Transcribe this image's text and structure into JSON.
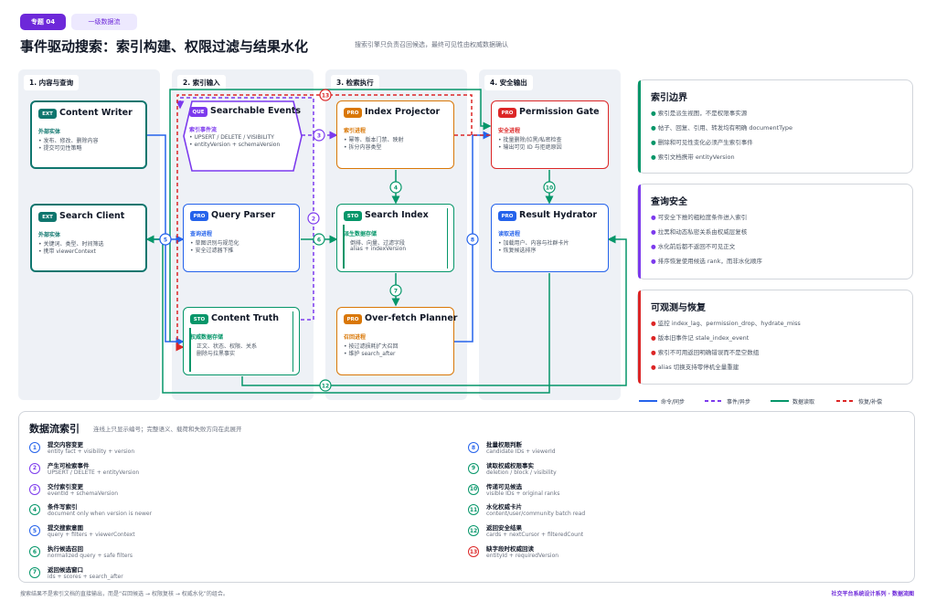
{
  "header": {
    "topic_tag": "专题 04",
    "level_tag": "一级数据流",
    "title": "事件驱动搜索：索引构建、权限过滤与结果水化",
    "subtitle": "搜索引擎只负责召回候选，最终可见性由权威数据确认"
  },
  "lanes": [
    {
      "title": "1. 内容与查询"
    },
    {
      "title": "2. 索引输入"
    },
    {
      "title": "3. 检索执行"
    },
    {
      "title": "4. 安全输出"
    }
  ],
  "nodes": {
    "content_writer": {
      "badge": "EXT",
      "name": "Content Writer",
      "role": "外部实体",
      "b1": "• 发布、修改、删除内容",
      "b2": "• 提交可见性策略"
    },
    "search_client": {
      "badge": "EXT",
      "name": "Search Client",
      "role": "外部实体",
      "b1": "• 关键词、类型、时间筛选",
      "b2": "• 携带 viewerContext"
    },
    "searchable_events": {
      "badge": "QUE",
      "name": "Searchable Events",
      "role": "索引事件流",
      "b1": "• UPSERT / DELETE / VISIBILITY",
      "b2": "• entityVersion + schemaVersion"
    },
    "query_parser": {
      "badge": "PRO",
      "name": "Query Parser",
      "role": "查询进程",
      "b1": "• 草图识别与规范化",
      "b2": "• 安全过滤器下推"
    },
    "content_truth": {
      "badge": "STO",
      "name": "Content Truth",
      "role": "权威数据存储",
      "b1": "正文、状态、权限、关系",
      "b2": "删除与拉黑事实"
    },
    "index_projector": {
      "badge": "PRO",
      "name": "Index Projector",
      "role": "索引进程",
      "b1": "• 幂等、版本门禁、映射",
      "b2": "• 拆分内容类型"
    },
    "search_index": {
      "badge": "STO",
      "name": "Search Index",
      "role": "派生数据存储",
      "b1": "倒排、向量、过滤字段",
      "b2": "alias + indexVersion"
    },
    "over_fetch_planner": {
      "badge": "PRO",
      "name": "Over-fetch Planner",
      "role": "召回进程",
      "b1": "• 按过滤损耗扩大召回",
      "b2": "• 维护 search_after"
    },
    "permission_gate": {
      "badge": "PRO",
      "name": "Permission Gate",
      "role": "安全进程",
      "b1": "• 批量删除/拉黑/私密检查",
      "b2": "• 输出可见 ID 与拒绝原因"
    },
    "result_hydrator": {
      "badge": "PRO",
      "name": "Result Hydrator",
      "role": "读取进程",
      "b1": "• 加载用户、内容与社群卡片",
      "b2": "• 恢复候选排序"
    }
  },
  "edge_numbers": [
    "1",
    "2",
    "3",
    "4",
    "5",
    "6",
    "7",
    "8",
    "9",
    "10",
    "11",
    "12",
    "13"
  ],
  "panels": [
    {
      "title": "索引边界",
      "color": "#059669",
      "items": [
        "索引是派生视图，不是权限事实源",
        "帖子、回复、引用、转发均有明确 documentType",
        "删除和可见性变化必须产生索引事件",
        "索引文档携带 entityVersion"
      ]
    },
    {
      "title": "查询安全",
      "color": "#7c3aed",
      "items": [
        "可安全下推的粗粒度条件进入索引",
        "拉黑和动态私密关系由权威层复核",
        "水化前后都不返回不可见正文",
        "排序恢复使用候选 rank，而非水化顺序"
      ]
    },
    {
      "title": "可观测与恢复",
      "color": "#dc2626",
      "items": [
        "监控 index_lag、permission_drop、hydrate_miss",
        "版本旧事件记 stale_index_event",
        "索引不可用返回明确错误而不是空数组",
        "alias 切换支持零停机全量重建"
      ]
    }
  ],
  "legend": [
    {
      "label": "命令/同步",
      "color": "#2563eb",
      "style": "solid"
    },
    {
      "label": "事件/异步",
      "color": "#7c3aed",
      "style": "dashed"
    },
    {
      "label": "数据读取",
      "color": "#059669",
      "style": "solid"
    },
    {
      "label": "恢复/补偿",
      "color": "#dc2626",
      "style": "dashed"
    }
  ],
  "index": {
    "title": "数据流索引",
    "desc": "连线上只显示编号；完整语义、载荷和失败方向在此展开",
    "items": [
      {
        "n": "1",
        "color": "#2563eb",
        "h": "提交内容变更",
        "s": "entity fact + visibility + version"
      },
      {
        "n": "2",
        "color": "#7c3aed",
        "h": "产生可检索事件",
        "s": "UPSERT / DELETE + entityVersion"
      },
      {
        "n": "3",
        "color": "#7c3aed",
        "h": "交付索引变更",
        "s": "eventId + schemaVersion"
      },
      {
        "n": "4",
        "color": "#059669",
        "h": "条件写索引",
        "s": "document only when version is newer"
      },
      {
        "n": "5",
        "color": "#2563eb",
        "h": "提交搜索意图",
        "s": "query + filters + viewerContext"
      },
      {
        "n": "6",
        "color": "#059669",
        "h": "执行候选召回",
        "s": "normalized query + safe filters"
      },
      {
        "n": "7",
        "color": "#059669",
        "h": "返回候选窗口",
        "s": "ids + scores + search_after"
      },
      {
        "n": "8",
        "color": "#2563eb",
        "h": "批量权限判断",
        "s": "candidate IDs + viewerId"
      },
      {
        "n": "9",
        "color": "#059669",
        "h": "读取权威权限事实",
        "s": "deletion / block / visibility"
      },
      {
        "n": "10",
        "color": "#059669",
        "h": "传递可见候选",
        "s": "visible IDs + original ranks"
      },
      {
        "n": "11",
        "color": "#059669",
        "h": "水化权威卡片",
        "s": "content/user/community batch read"
      },
      {
        "n": "12",
        "color": "#059669",
        "h": "返回安全结果",
        "s": "cards + nextCursor + filteredCount"
      },
      {
        "n": "13",
        "color": "#dc2626",
        "h": "缺字段时权威回读",
        "s": "entityId + requiredVersion"
      }
    ]
  },
  "footer": {
    "left": "搜索结果不是索引文档的直接输出，而是“召回候选 → 权限复核 → 权威水化”的组合。",
    "right": "社交平台系统设计系列 · 数据流图"
  }
}
